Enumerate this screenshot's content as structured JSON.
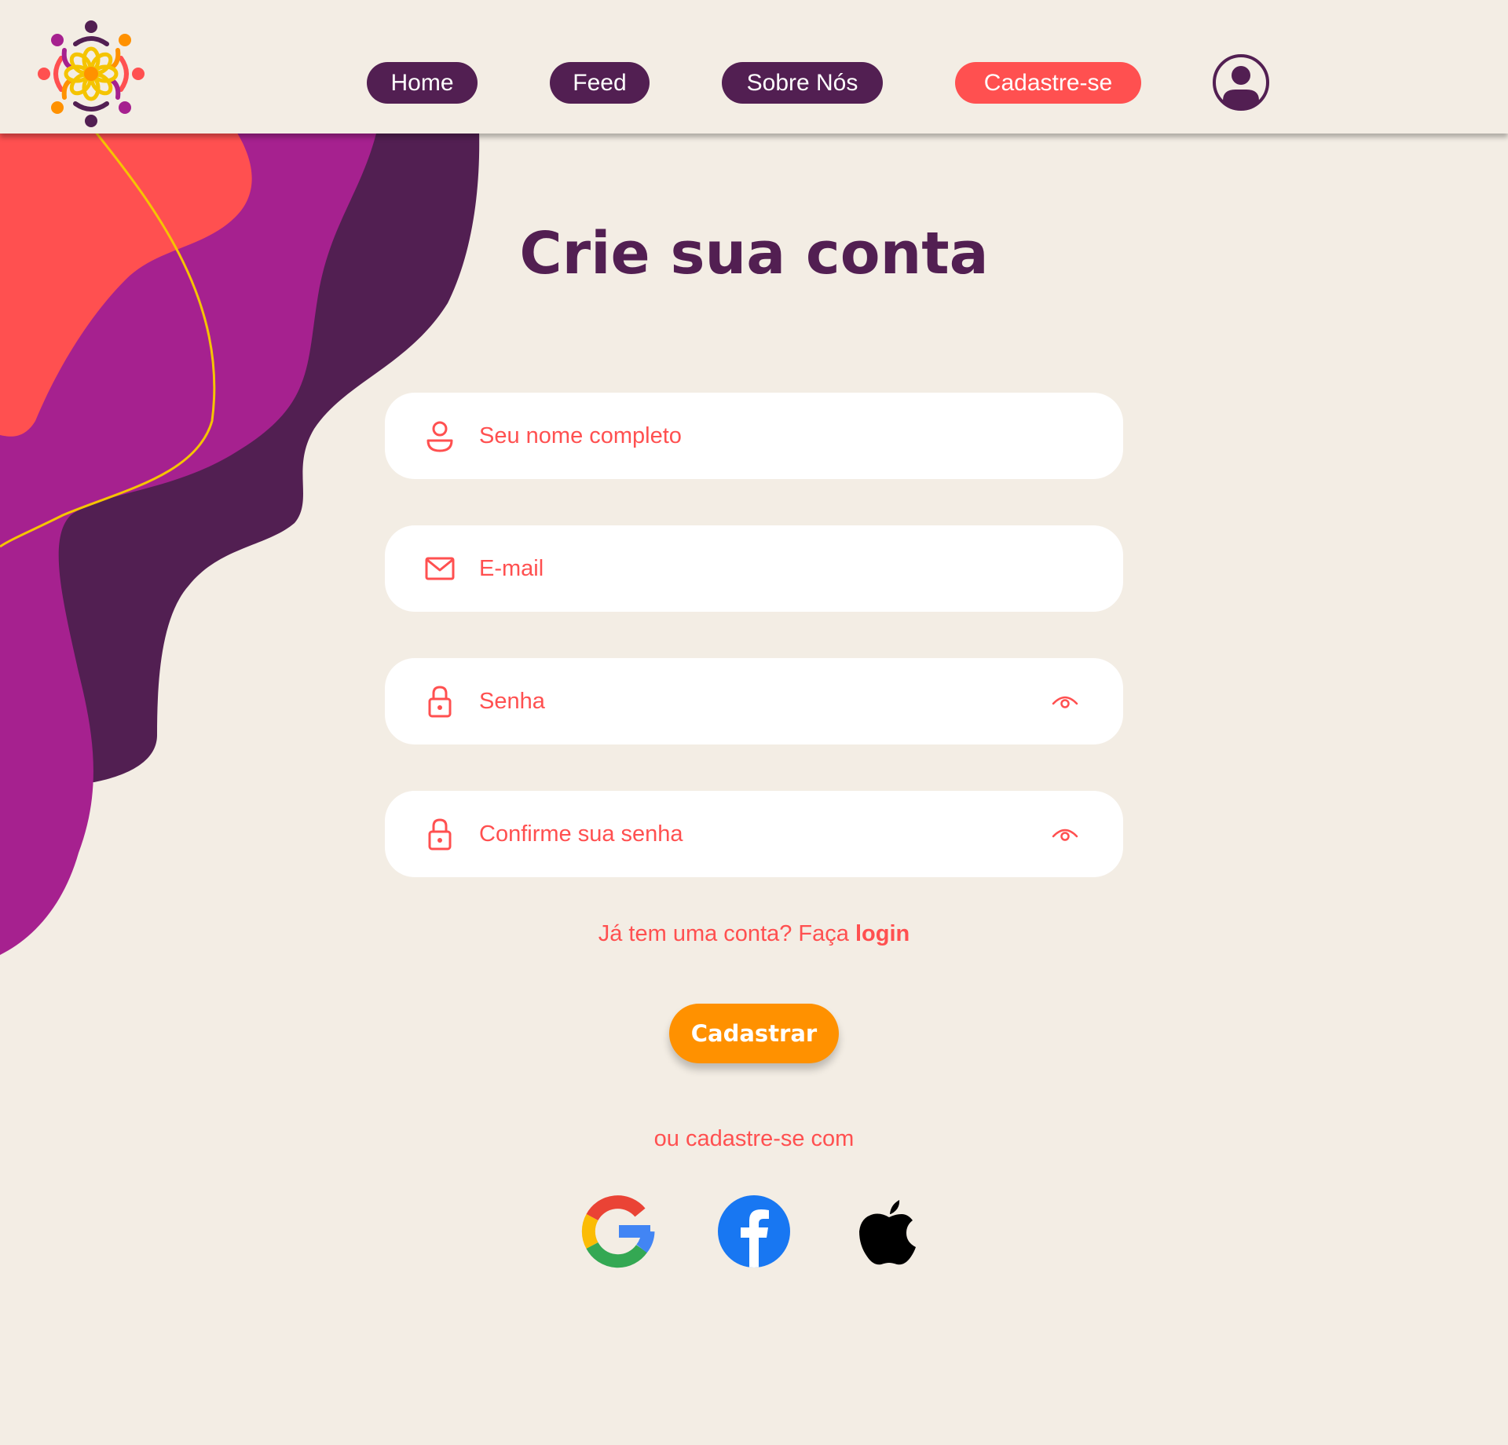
{
  "nav": {
    "home": "Home",
    "feed": "Feed",
    "sobre": "Sobre Nós",
    "cadastre": "Cadastre-se"
  },
  "colors": {
    "background": "#F3EDE4",
    "purple_dark": "#521F52",
    "magenta": "#A6218F",
    "coral": "#FF5050",
    "orange": "#FF9100",
    "yellow": "#F5C400"
  },
  "icons": {
    "logo": "community-logo",
    "profile": "user-circle-icon",
    "name": "user-icon",
    "email": "mail-icon",
    "password": "lock-icon",
    "show_password": "eye-icon",
    "google": "google-icon",
    "facebook": "facebook-icon",
    "apple": "apple-icon"
  },
  "form": {
    "title": "Crie sua conta",
    "name_placeholder": "Seu nome completo",
    "email_placeholder": "E-mail",
    "password_placeholder": "Senha",
    "confirm_placeholder": "Confirme sua senha",
    "login_prompt": "Já tem uma conta? Faça",
    "login_link": "login",
    "submit_label": "Cadastrar",
    "alt_signup": "ou cadastre-se com"
  }
}
